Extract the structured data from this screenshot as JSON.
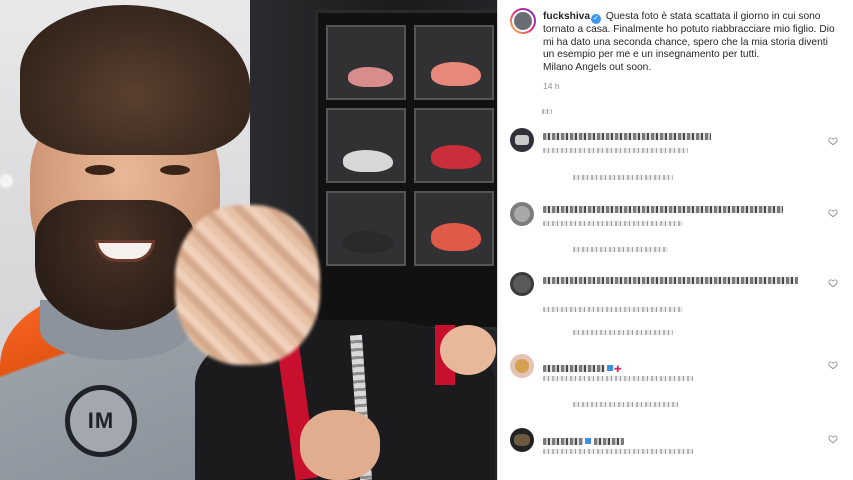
{
  "post": {
    "username": "fuckshiva",
    "caption": "Questa foto è stata scattata il giorno in cui sono tornato a casa. Finalmente ho potuto riabbracciare mio figlio. Dio mi ha dato una seconda chance, spero che la mia storia diventi un esempio per me e un insegnamento per tutti.",
    "caption_line2": "Milano Angels out soon.",
    "time": "14 h",
    "verified_icon": "verified-badge-icon",
    "photo_logo_text": "IM"
  },
  "comments": [
    {
      "id": "c1",
      "avatar_color": "#2f2f3a",
      "line1_w": 205,
      "line2_w": 145,
      "replies_w": 100,
      "name_text": ""
    },
    {
      "id": "c2",
      "avatar_color": "#7c7c7e",
      "line1_w": 240,
      "line2_w": 140,
      "replies_w": 95,
      "name_text": ""
    },
    {
      "id": "c3",
      "avatar_color": "#3b3b3b",
      "line1_w": 255,
      "line2_w": 140,
      "replies_w": 100,
      "name_text": ""
    },
    {
      "id": "c4",
      "avatar_color": "#e3c3b3",
      "line1_w": 0,
      "line2_w": 150,
      "replies_w": 105,
      "name_text": ""
    },
    {
      "id": "c5",
      "avatar_color": "#222222",
      "line1_w": 90,
      "line2_w": 150,
      "replies_w": 0,
      "name_text": ""
    }
  ],
  "icons": {
    "heart": "heart-outline-icon"
  },
  "colors": {
    "accent_blue": "#3897f0",
    "muted_text": "#8e8e8e",
    "divider": "#dbdbdb"
  }
}
